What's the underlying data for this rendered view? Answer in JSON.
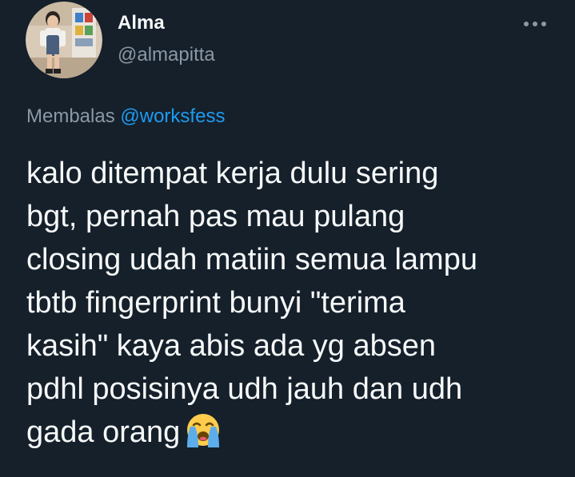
{
  "tweet": {
    "author": {
      "display_name": "Alma",
      "handle": "@almapitta"
    },
    "menu_icon": "more-horizontal-icon",
    "reply": {
      "prefix": "Membalas",
      "mention": "@worksfess"
    },
    "text_lines": [
      "kalo ditempat kerja dulu sering",
      "bgt, pernah pas mau pulang",
      "closing udah matiin semua lampu",
      "tbtb fingerprint bunyi \"terima",
      "kasih\" kaya abis ada yg absen",
      "pdhl posisinya udh jauh dan udh",
      "gada orang"
    ],
    "trailing_emoji": "loudly-crying-face-emoji"
  },
  "colors": {
    "background": "#15202b",
    "text_primary": "#f7f9f9",
    "text_secondary": "#8b98a5",
    "link": "#1d9bf0"
  }
}
